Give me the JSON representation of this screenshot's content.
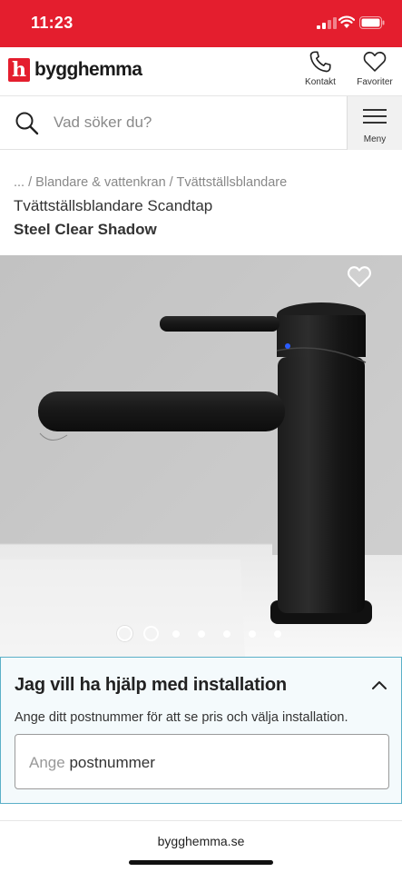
{
  "status_bar": {
    "time": "11:23"
  },
  "header": {
    "logo_text": "bygghemma",
    "logo_mark": "h",
    "kontakt_label": "Kontakt",
    "favoriter_label": "Favoriter",
    "brand_color": "#e41e2e"
  },
  "search": {
    "placeholder": "Vad söker du?",
    "menu_label": "Meny"
  },
  "breadcrumb": "... / Blandare & vattenkran / Tvättställsblandare",
  "product": {
    "subtitle": "Tvättställsblandare Scandtap",
    "title": "Steel Clear Shadow",
    "image_count": 7,
    "active_image": 1
  },
  "installation": {
    "title": "Jag vill ha hjälp med installation",
    "description": "Ange ditt postnummer för att se pris och välja installation.",
    "input_placeholder_prefix": "Ange",
    "input_placeholder_value": "postnummer"
  },
  "browser": {
    "url": "bygghemma.se"
  },
  "icons": [
    "phone-icon",
    "heart-icon",
    "search-icon",
    "hamburger-icon",
    "chevron-up-icon",
    "signal-icon",
    "wifi-icon",
    "battery-icon"
  ]
}
